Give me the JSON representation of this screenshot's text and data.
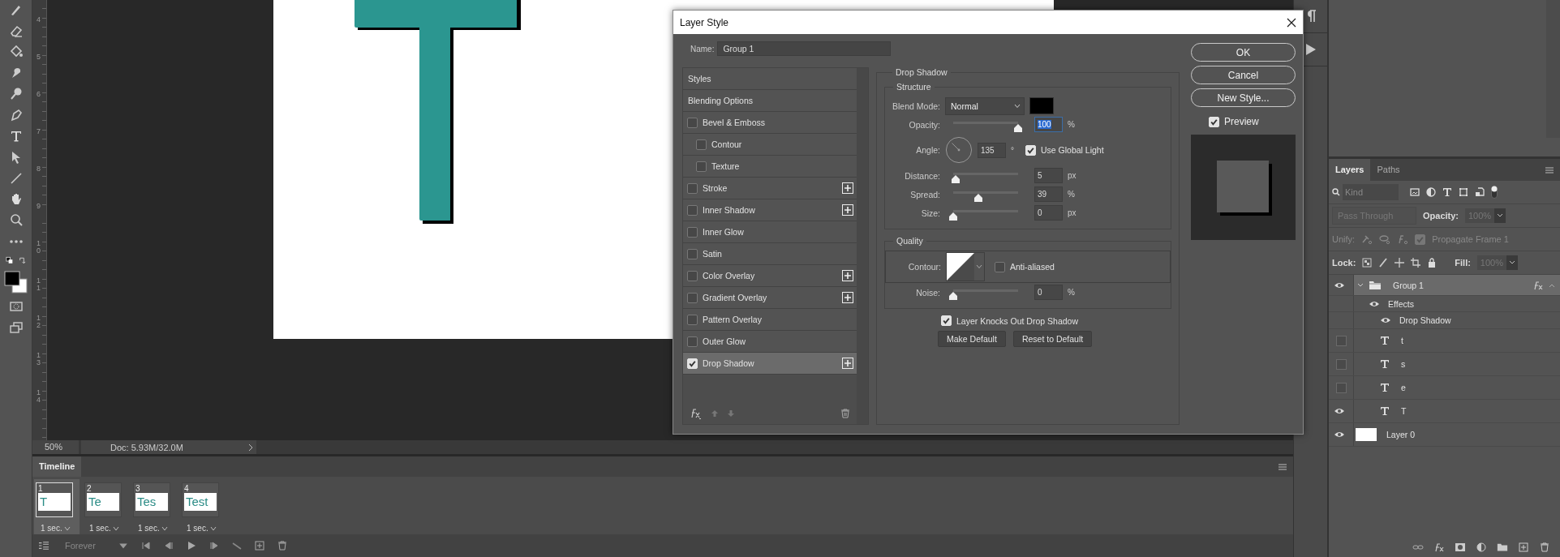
{
  "ruler": {
    "marks": [
      "4",
      "5",
      "6",
      "7",
      "8",
      "9",
      "10",
      "11",
      "12",
      "13",
      "14"
    ]
  },
  "status_bar": {
    "zoom": "50%",
    "doc_info": "Doc: 5.93M/32.0M"
  },
  "timeline": {
    "title": "Timeline",
    "loop": "Forever",
    "frames": [
      {
        "number": "1",
        "thumbnail_text": "T",
        "delay": "1 sec.",
        "selected": true
      },
      {
        "number": "2",
        "thumbnail_text": "Te",
        "delay": "1 sec.",
        "selected": false
      },
      {
        "number": "3",
        "thumbnail_text": "Tes",
        "delay": "1 sec.",
        "selected": false
      },
      {
        "number": "4",
        "thumbnail_text": "Test",
        "delay": "1 sec.",
        "selected": false
      }
    ]
  },
  "dialog": {
    "title": "Layer Style",
    "name_label": "Name:",
    "name_value": "Group 1",
    "styles": [
      {
        "label": "Styles",
        "kind": "header",
        "selected": false
      },
      {
        "label": "Blending Options",
        "kind": "header",
        "selected": false
      },
      {
        "label": "Bevel & Emboss",
        "kind": "effect",
        "checked": false,
        "selected": false,
        "children": [
          {
            "label": "Contour",
            "kind": "effect",
            "checked": false,
            "selected": false
          },
          {
            "label": "Texture",
            "kind": "effect",
            "checked": false,
            "selected": false
          }
        ]
      },
      {
        "label": "Stroke",
        "kind": "effect",
        "checked": false,
        "addable": true,
        "selected": false
      },
      {
        "label": "Inner Shadow",
        "kind": "effect",
        "checked": false,
        "addable": true,
        "selected": false
      },
      {
        "label": "Inner Glow",
        "kind": "effect",
        "checked": false,
        "selected": false
      },
      {
        "label": "Satin",
        "kind": "effect",
        "checked": false,
        "selected": false
      },
      {
        "label": "Color Overlay",
        "kind": "effect",
        "checked": false,
        "addable": true,
        "selected": false
      },
      {
        "label": "Gradient Overlay",
        "kind": "effect",
        "checked": false,
        "addable": true,
        "selected": false
      },
      {
        "label": "Pattern Overlay",
        "kind": "effect",
        "checked": false,
        "selected": false
      },
      {
        "label": "Outer Glow",
        "kind": "effect",
        "checked": false,
        "selected": false
      },
      {
        "label": "Drop Shadow",
        "kind": "effect",
        "checked": true,
        "addable": true,
        "selected": true
      }
    ],
    "panel": {
      "title": "Drop Shadow",
      "structure": {
        "title": "Structure",
        "rows": [
          {
            "kind": "select",
            "label": "Blend Mode:",
            "value": "Normal",
            "color": "#000000"
          },
          {
            "kind": "slider",
            "label": "Opacity:",
            "level": 1,
            "value": "100",
            "unit": "%",
            "focused": true
          },
          {
            "kind": "angle",
            "label": "Angle:",
            "value": "135",
            "unit": "°",
            "checkbox": {
              "label": "Use Global Light",
              "checked": true
            }
          },
          {
            "kind": "slider",
            "label": "Distance:",
            "level": 0.04,
            "value": "5",
            "unit": "px",
            "focused": false
          },
          {
            "kind": "slider",
            "label": "Spread:",
            "level": 0.39,
            "value": "39",
            "unit": "%",
            "focused": false
          },
          {
            "kind": "slider",
            "label": "Size:",
            "level": 0,
            "value": "0",
            "unit": "px",
            "focused": false
          }
        ]
      },
      "quality": {
        "title": "Quality",
        "rows": [
          {
            "kind": "contour",
            "label": "Contour:",
            "checkbox": {
              "label": "Anti-aliased",
              "checked": false
            }
          },
          {
            "kind": "slider",
            "label": "Noise:",
            "level": 0,
            "value": "0",
            "unit": "%",
            "focused": false
          }
        ]
      },
      "knockout": {
        "label": "Layer Knocks Out Drop Shadow",
        "checked": true
      },
      "buttons": [
        "Make Default",
        "Reset to Default"
      ]
    },
    "actions": [
      "OK",
      "Cancel",
      "New Style..."
    ],
    "preview": {
      "label": "Preview",
      "checked": true
    }
  },
  "layers_panel": {
    "tabs": [
      {
        "label": "Layers",
        "selected": true
      },
      {
        "label": "Paths",
        "selected": false
      }
    ],
    "filter": {
      "placeholder": "Kind"
    },
    "blend_mode": {
      "value": "Pass Through",
      "disabled": true
    },
    "opacity": {
      "label": "Opacity:",
      "value": "100%",
      "disabled": true
    },
    "unify": {
      "label": "Unify:",
      "propagate": {
        "label": "Propagate Frame 1",
        "checked": true
      }
    },
    "lock": {
      "label": "Lock:"
    },
    "fill": {
      "label": "Fill:",
      "value": "100%",
      "disabled": true
    },
    "layers": [
      {
        "name": "Group 1",
        "kind": "group",
        "visible": true,
        "selected": true,
        "expanded": true,
        "has_effects": true,
        "children": [
          {
            "name": "Effects",
            "kind": "effects",
            "visible": true,
            "children": [
              {
                "name": "Drop Shadow",
                "kind": "effect",
                "visible": true
              }
            ]
          },
          {
            "name": "t",
            "kind": "text",
            "visible": false,
            "selected": false
          },
          {
            "name": "s",
            "kind": "text",
            "visible": false,
            "selected": false
          },
          {
            "name": "e",
            "kind": "text",
            "visible": false,
            "selected": false
          },
          {
            "name": "T",
            "kind": "text",
            "visible": true,
            "selected": false
          }
        ]
      },
      {
        "name": "Layer 0",
        "kind": "pixel",
        "visible": true,
        "selected": false
      }
    ]
  }
}
